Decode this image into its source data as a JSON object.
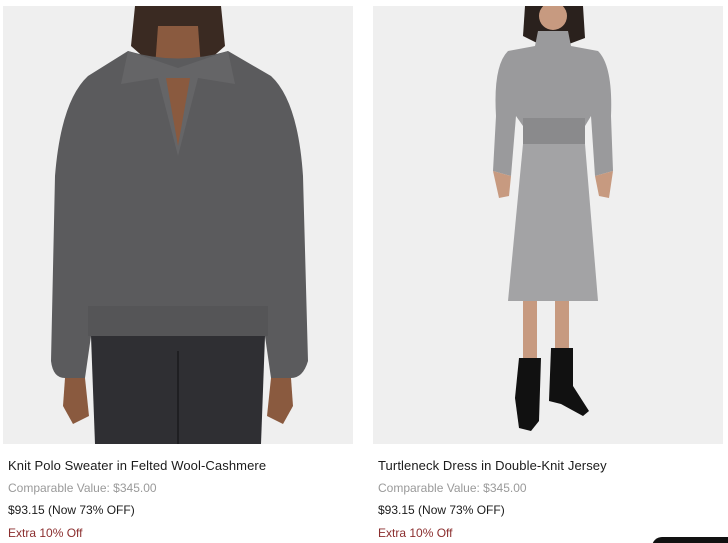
{
  "products": [
    {
      "name": "Knit Polo Sweater in Felted Wool-Cashmere",
      "comparable": "Comparable Value: $345.00",
      "price": "$93.15 (Now 73% OFF)",
      "promo": "Extra 10% Off"
    },
    {
      "name": "Turtleneck Dress in Double-Knit Jersey",
      "comparable": "Comparable Value: $345.00",
      "price": "$93.15 (Now 73% OFF)",
      "promo": "Extra 10% Off"
    }
  ],
  "colors": {
    "promo": "#8b2e2e",
    "image_bg": "#efefef",
    "muted": "#9a9a9a"
  }
}
